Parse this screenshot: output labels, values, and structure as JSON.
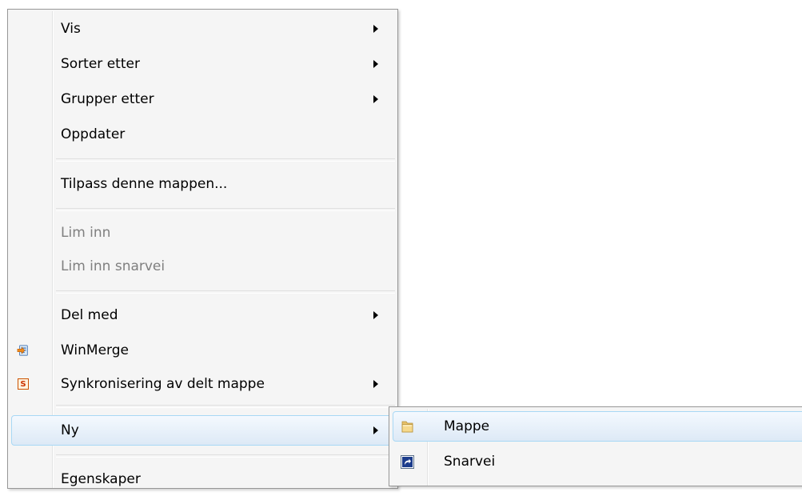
{
  "context_menu": {
    "items": [
      {
        "label": "Vis",
        "submenu": true
      },
      {
        "label": "Sorter etter",
        "submenu": true
      },
      {
        "label": "Grupper etter",
        "submenu": true
      },
      {
        "label": "Oppdater"
      },
      {
        "label": "Tilpass denne mappen..."
      },
      {
        "label": "Lim inn",
        "disabled": true
      },
      {
        "label": "Lim inn snarvei",
        "disabled": true
      },
      {
        "label": "Del med",
        "submenu": true
      },
      {
        "label": "WinMerge",
        "icon": "winmerge-icon"
      },
      {
        "label": "Synkronisering av delt mappe",
        "icon": "sync-s-icon",
        "submenu": true
      },
      {
        "label": "Ny",
        "submenu": true,
        "highlighted": true
      },
      {
        "label": "Egenskaper"
      }
    ]
  },
  "new_submenu": {
    "items": [
      {
        "label": "Mappe",
        "icon": "folder-icon",
        "highlighted": true
      },
      {
        "label": "Snarvei",
        "icon": "shortcut-icon"
      }
    ]
  },
  "colors": {
    "menu_background": "#f5f5f5",
    "menu_border": "#979797",
    "highlight_border": "#a8d8f5",
    "disabled_text": "#7f7f7f"
  }
}
